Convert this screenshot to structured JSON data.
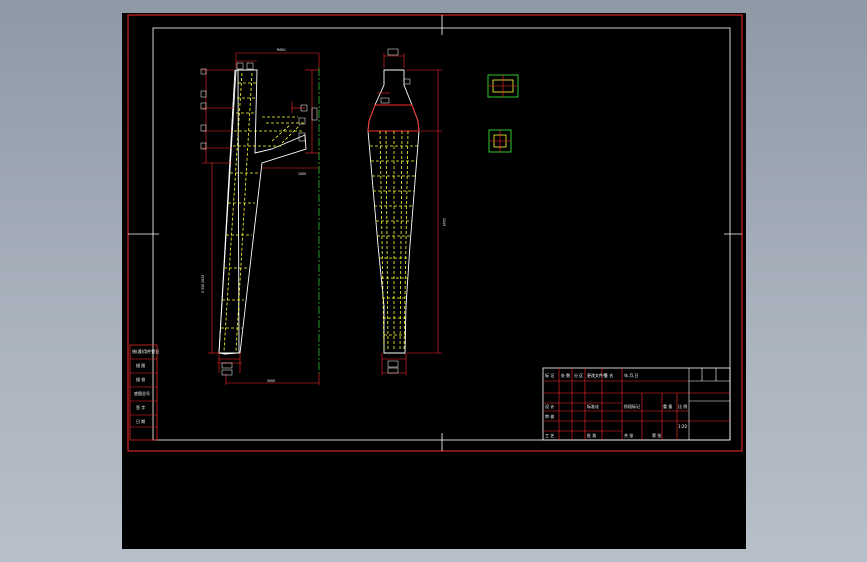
{
  "drawing": {
    "colors": {
      "background": "#000000",
      "frame": "#ff2a2a",
      "outline": "#ffffff",
      "hidden": "#ffff33",
      "centerline": "#33dd33",
      "dimension": "#ff2a2a"
    },
    "dimensions": {
      "top_width": "R0R0",
      "inlet_width": "5",
      "outlet_dia": "3205",
      "total_height": "1149",
      "cone_length": "5 350 2025",
      "bottom_offset": "5000",
      "side_label_a": "5000",
      "side_label_b": "2500",
      "side_label_c": "1000"
    },
    "title_block": {
      "cells": [
        "标 记",
        "处 数",
        "分 区",
        "更改文件号",
        "签 名",
        "年.月.日",
        "设 计",
        "标准化",
        "阶段标记",
        "重 量",
        "比 例",
        "审 核",
        "工 艺",
        "批 准",
        "共 张",
        "第 张"
      ],
      "scale": "1:20"
    },
    "left_strip": [
      "借(通)用件登记",
      "描 图",
      "描 校",
      "底图总号",
      "签 字",
      "日 期"
    ]
  }
}
